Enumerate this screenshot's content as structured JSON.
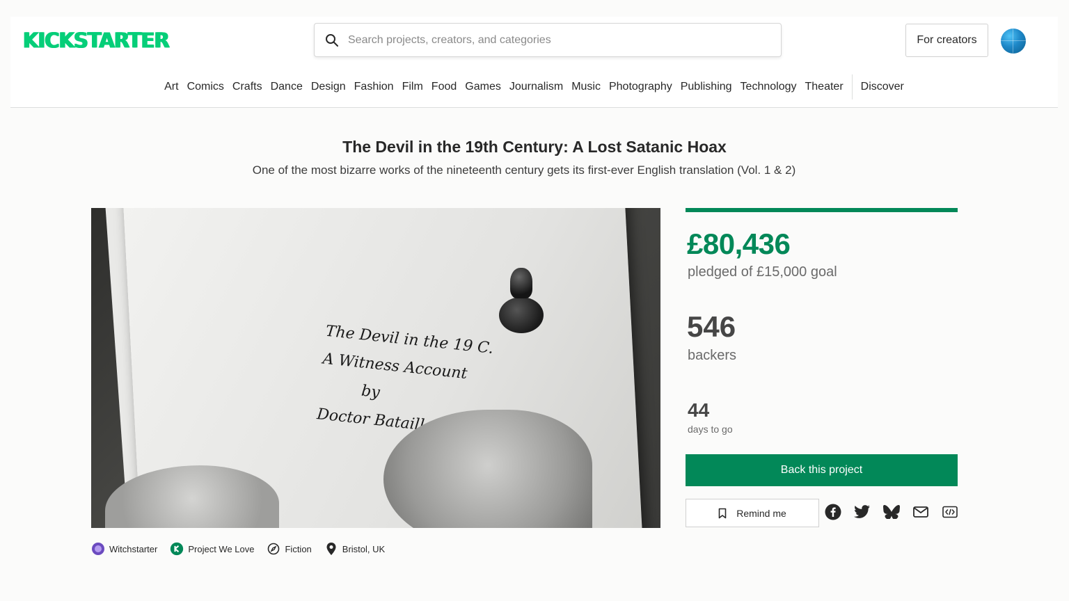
{
  "header": {
    "logo_text": "KICKSTARTER",
    "search_placeholder": "Search projects, creators, and categories",
    "for_creators_label": "For creators"
  },
  "nav": {
    "categories": [
      "Art",
      "Comics",
      "Crafts",
      "Dance",
      "Design",
      "Fashion",
      "Film",
      "Food",
      "Games",
      "Journalism",
      "Music",
      "Photography",
      "Publishing",
      "Technology",
      "Theater"
    ],
    "discover_label": "Discover"
  },
  "project": {
    "title": "The Devil in the 19th Century: A Lost Satanic Hoax",
    "subtitle": "One of the most bizarre works of the nineteenth century gets its first-ever English translation (Vol. 1 & 2)",
    "image_script_lines": [
      "The Devil in the 19 C.",
      "A Witness Account",
      "by",
      "Doctor Bataille"
    ]
  },
  "tags": [
    {
      "icon": "witch-icon",
      "label": "Witchstarter"
    },
    {
      "icon": "kickstarter-badge-icon",
      "label": "Project We Love"
    },
    {
      "icon": "compass-icon",
      "label": "Fiction"
    },
    {
      "icon": "location-pin-icon",
      "label": "Bristol, UK"
    }
  ],
  "stats": {
    "pledged": "£80,436",
    "pledged_goal_text": "pledged of £15,000 goal",
    "funding_progress": 1.0,
    "backers": "546",
    "backers_label": "backers",
    "days": "44",
    "days_label": "days to go"
  },
  "actions": {
    "back_label": "Back this project",
    "remind_label": "Remind me",
    "share_icons": [
      "facebook-icon",
      "twitter-icon",
      "bluesky-icon",
      "email-icon",
      "embed-icon"
    ]
  },
  "colors": {
    "brand_green": "#05ce78",
    "action_green": "#028858",
    "text_dark": "#282828"
  }
}
